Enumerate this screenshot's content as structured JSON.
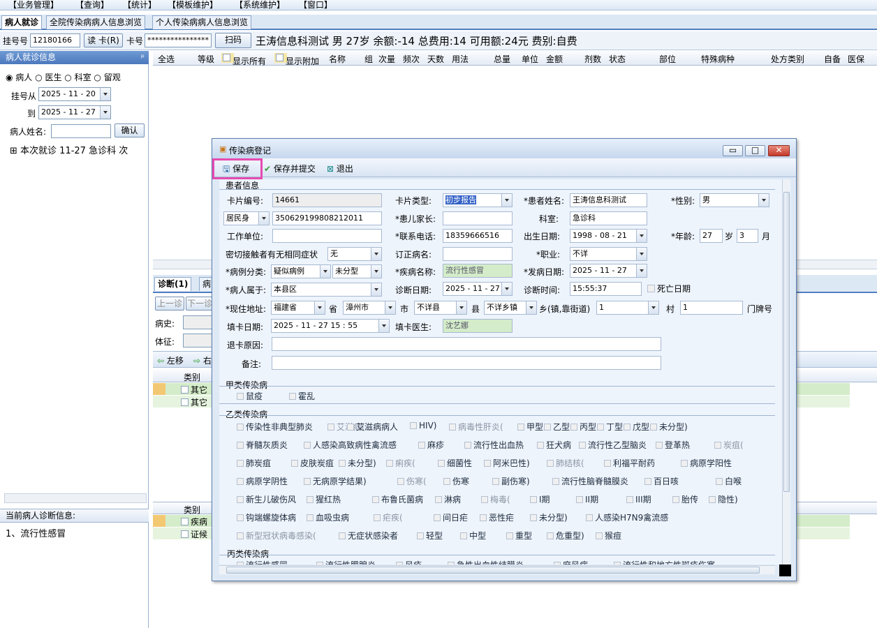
{
  "menu": [
    "【业务管理】",
    "【查询】",
    "【统计】",
    "【模板维护】",
    "【系统维护】",
    "【窗口】"
  ],
  "tabs": [
    "病人就诊",
    "全院传染病病人信息浏览",
    "个人传染病病人信息浏览"
  ],
  "patient_bar": {
    "reg_label": "挂号号",
    "reg_no": "12180166",
    "read_card": "读 卡(R)",
    "card_label": "卡号",
    "card_no": "****************",
    "scan": "扫码",
    "summary": "王涛信息科测试 男 27岁 余额:-14 总费用:14 可用额:24元 费别:自费"
  },
  "left": {
    "header": "病人就诊信息",
    "pin": "ꟼ",
    "radios": [
      "病人",
      "医生",
      "科室",
      "留观"
    ],
    "from_label": "挂号从",
    "from_date": "2025 - 11 - 20",
    "to_label": "到",
    "to_date": "2025 - 11 - 27",
    "name_label": "病人姓名:",
    "confirm": "确认",
    "tree_item": "本次就诊 11-27 急诊科 次",
    "current_header": "当前病人诊断信息:",
    "current_diag": "1、流行性感冒"
  },
  "grid_headers": [
    "全选",
    "等级",
    "显示所有",
    "显示附加",
    "名称",
    "组",
    "次量",
    "频次",
    "天数",
    "用法",
    "总量",
    "单位",
    "金额",
    "剂数",
    "状态",
    "部位",
    "特殊病种",
    "处方类别",
    "自备",
    "医保"
  ],
  "mid": {
    "tab_diag": "诊断(1)",
    "tab2": "病",
    "btn_up": "上一诊",
    "btn_down": "下一诊",
    "history": "病史:",
    "sign": "体征:",
    "left_move": "左移",
    "right_move": "右",
    "type_col": "类别",
    "row_a1": "其它",
    "row_a2": "其它",
    "row_b1": "疾病",
    "row_b2": "证候"
  },
  "dialog": {
    "title": "传染病登记",
    "save": "保存",
    "save_submit": "保存并提交",
    "exit": "退出",
    "section_patient": "患者信息",
    "card_no_label": "卡片编号:",
    "card_no": "14661",
    "card_type_label": "卡片类型:",
    "card_type": "初步报告",
    "name_label": "*患者姓名:",
    "name": "王涛信息科测试",
    "sex_label": "*性别:",
    "sex": "男",
    "id_type": "居民身",
    "id_no": "350629199808212011",
    "parent_label": "*患儿家长:",
    "parent": "",
    "dept_label": "科室:",
    "dept": "急诊科",
    "work_label": "工作单位:",
    "work": "",
    "phone_label": "*联系电话:",
    "phone": "18359666516",
    "birth_label": "出生日期:",
    "birth": "1998 - 08 - 21",
    "age_label": "*年龄:",
    "age_y": "27",
    "age_y_unit": "岁",
    "age_m": "3",
    "age_m_unit": "月",
    "contact_label": "密切接触者有无相同症状",
    "contact": "无",
    "corrected_label": "订正病名:",
    "corrected": "",
    "job_label": "*职业:",
    "job": "不详",
    "case_label": "*病例分类:",
    "case_cls": "疑似病例",
    "case_sub": "未分型",
    "disease_label": "*疾病名称:",
    "disease": "流行性感冒",
    "onset_label": "*发病日期:",
    "onset": "2025 - 11 - 27",
    "belong_label": "*病人属于:",
    "belong": "本县区",
    "diag_date_label": "诊断日期:",
    "diag_date": "2025 - 11 - 27",
    "diag_time_label": "诊断时间:",
    "diag_time": "15:55:37",
    "death_label": "死亡日期",
    "addr_label": "*现住地址:",
    "province": "福建省",
    "province_u": "省",
    "city": "漳州市",
    "city_u": "市",
    "county": "不详县",
    "county_u": "县",
    "town": "不详乡镇",
    "town_u": "乡(镇,靠街道)",
    "village": "1",
    "village_u": "村",
    "door": "1",
    "door_u": "门牌号",
    "fill_date_label": "填卡日期:",
    "fill_date": "2025 - 11 - 27   15 : 55",
    "doctor_label": "填卡医生:",
    "doctor": "沈艺娜",
    "return_label": "退卡原因:",
    "return_val": "",
    "remark_label": "备注:",
    "remark_val": "",
    "group_a": "甲类传染病",
    "group_a_items": [
      "鼠疫",
      "霍乱"
    ],
    "group_b": "乙类传染病",
    "group_b_rows": [
      [
        "传染性非典型肺炎",
        "艾滋病(",
        "艾滋病病人",
        "HIV)",
        "病毒性肝炎(",
        "甲型",
        "乙型",
        "丙型",
        "丁型",
        "戊型",
        "未分型)"
      ],
      [
        "脊髓灰质炎",
        "人感染高致病性禽流感",
        "麻疹",
        "流行性出血热",
        "狂犬病",
        "流行性乙型脑炎",
        "登革热",
        "炭疽("
      ],
      [
        "肺炭疽",
        "皮肤炭疽",
        "未分型)",
        "痢疾(",
        "细菌性",
        "阿米巴性)",
        "肺结核(",
        "利福平耐药",
        "病原学阳性"
      ],
      [
        "病原学阴性",
        "无病原学结果)",
        "伤寒(",
        "伤寒",
        "副伤寒)",
        "流行性脑脊髓膜炎",
        "百日咳",
        "白喉"
      ],
      [
        "新生儿破伤风",
        "猩红热",
        "布鲁氏菌病",
        "淋病",
        "梅毒(",
        "I期",
        "II期",
        "III期",
        "胎传",
        "隐性)"
      ],
      [
        "钩端螺旋体病",
        "血吸虫病",
        "疟疾(",
        "间日疟",
        "恶性疟",
        "未分型)",
        "人感染H7N9禽流感"
      ],
      [
        "新型冠状病毒感染(",
        "无症状感染者",
        "轻型",
        "中型",
        "重型",
        "危重型)",
        "猴痘"
      ]
    ],
    "group_c": "丙类传染病",
    "group_c_items": [
      "流行性感冒",
      "流行性腮腺炎",
      "风疹",
      "急性出血性结膜炎",
      "麻风病",
      "流行性和地方性斑疹伤寒"
    ]
  }
}
